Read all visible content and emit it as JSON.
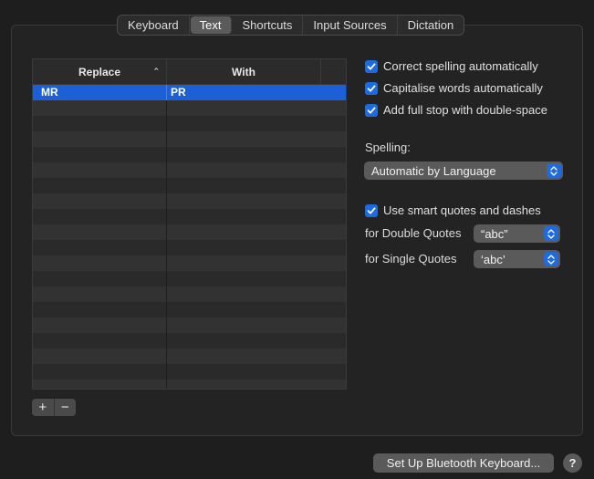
{
  "tabs": [
    "Keyboard",
    "Text",
    "Shortcuts",
    "Input Sources",
    "Dictation"
  ],
  "active_tab": "Text",
  "table": {
    "col_replace": "Replace",
    "col_with": "With",
    "rows": [
      {
        "replace": "MR",
        "with": "PR",
        "selected": true
      }
    ]
  },
  "add_label": "+",
  "remove_label": "−",
  "checks": {
    "correct_spelling": "Correct spelling automatically",
    "capitalise": "Capitalise words automatically",
    "full_stop": "Add full stop with double-space",
    "smart_quotes": "Use smart quotes and dashes"
  },
  "spelling_label": "Spelling:",
  "spelling_value": "Automatic by Language",
  "double_quotes_label": "for Double Quotes",
  "double_quotes_value": "“abc”",
  "single_quotes_label": "for Single Quotes",
  "single_quotes_value": "‘abc’",
  "bluetooth_button": "Set Up Bluetooth Keyboard...",
  "help_label": "?",
  "colors": {
    "accent": "#1e6be0",
    "selection": "#1d5fd6"
  }
}
